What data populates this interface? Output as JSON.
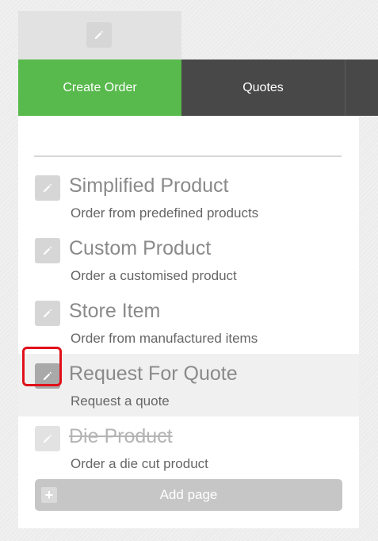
{
  "tabs": [
    {
      "label": "Create Order",
      "active": true
    },
    {
      "label": "Quotes",
      "active": false
    },
    {
      "label": "",
      "active": false
    }
  ],
  "page_items": [
    {
      "title": "Simplified Product",
      "description": "Order from predefined products",
      "highlighted": false,
      "strikethrough": false
    },
    {
      "title": "Custom Product",
      "description": "Order a customised product",
      "highlighted": false,
      "strikethrough": false
    },
    {
      "title": "Store Item",
      "description": "Order from manufactured items",
      "highlighted": false,
      "strikethrough": false
    },
    {
      "title": "Request For Quote",
      "description": "Request a quote",
      "highlighted": true,
      "strikethrough": false
    },
    {
      "title": "Die Product",
      "description": "Order a die cut product",
      "highlighted": false,
      "strikethrough": true
    }
  ],
  "add_page": {
    "label": "Add page",
    "icon": "plus-icon"
  },
  "icons": {
    "edit": "pencil-icon"
  },
  "colors": {
    "active_tab": "#58b94c",
    "inactive_tab": "#484848",
    "highlight_outline": "#e0101a",
    "button": "#c6c6c6"
  }
}
